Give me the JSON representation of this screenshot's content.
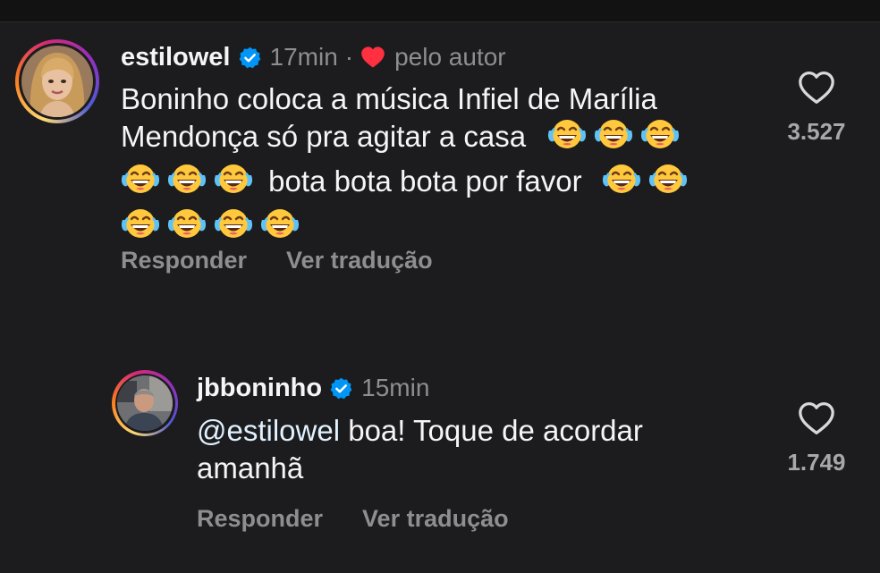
{
  "colors": {
    "background": "#1c1c1e",
    "text": "#f5f5f5",
    "muted": "#8e8e8e",
    "verified": "#0095f6",
    "heart_red": "#ff3040",
    "emoji_yellow": "#ffc83d"
  },
  "comments": [
    {
      "username": "estilowel",
      "verified": true,
      "time": "17min",
      "separator": "·",
      "liked_by_author_label": "pelo autor",
      "text_lines": [
        "Boninho coloca a música Infiel de Marília",
        "Mendonça só pra agitar a casa",
        "bota bota bota por favor"
      ],
      "emoji": "face-with-tears-of-joy",
      "reply_label": "Responder",
      "translate_label": "Ver tradução",
      "like_count": "3.527",
      "like_icon": "heart-outline-icon"
    },
    {
      "username": "jbboninho",
      "verified": true,
      "time": "15min",
      "mention": "@estilowel",
      "text_line1_rest": " boa! Toque de acordar",
      "text_line2": "amanhã",
      "reply_label": "Responder",
      "translate_label": "Ver tradução",
      "like_count": "1.749",
      "like_icon": "heart-outline-icon"
    }
  ]
}
